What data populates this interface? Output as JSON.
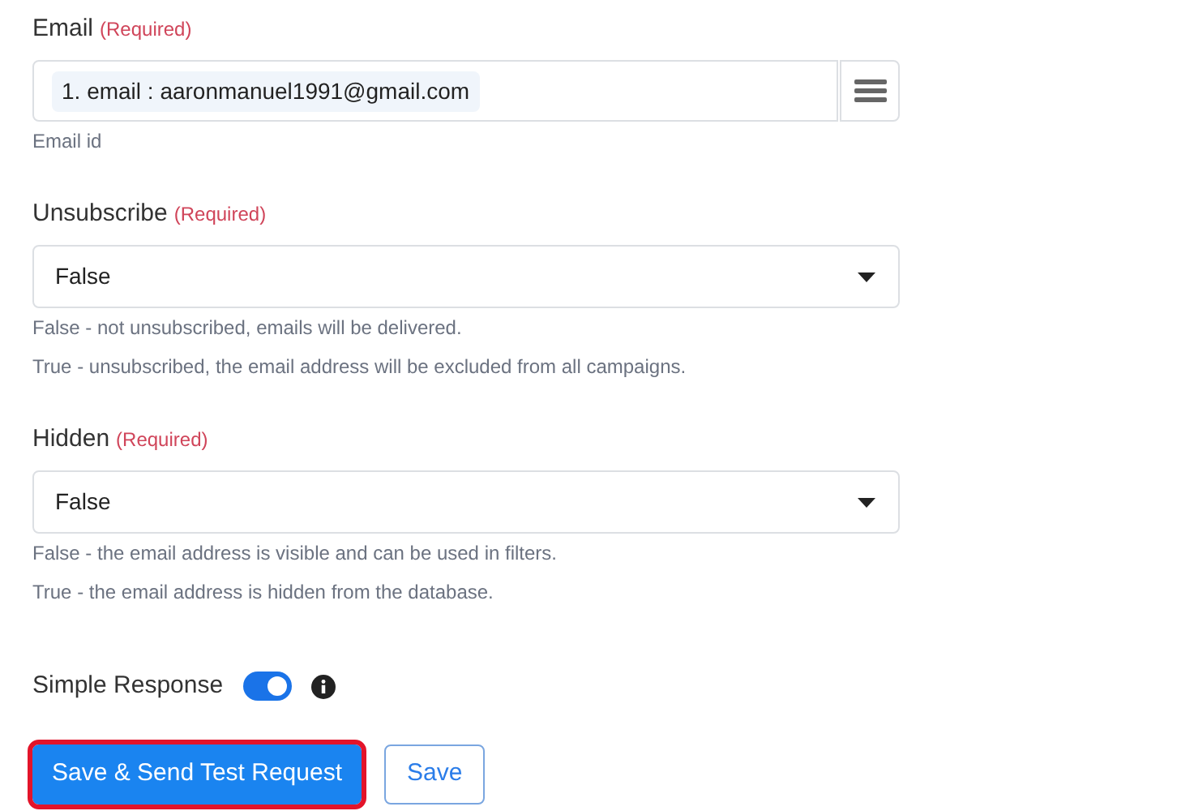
{
  "fields": [
    {
      "kind": "tag_input",
      "label": "Email",
      "required_note": "(Required)",
      "tag": "1. email : aaronmanuel1991@gmail.com",
      "help": [
        "Email id"
      ]
    },
    {
      "kind": "select",
      "label": "Unsubscribe",
      "required_note": "(Required)",
      "value": "False",
      "help": [
        "False - not unsubscribed, emails will be delivered.",
        "True - unsubscribed, the email address will be excluded from all campaigns."
      ]
    },
    {
      "kind": "select",
      "label": "Hidden",
      "required_note": "(Required)",
      "value": "False",
      "help": [
        "False - the email address is visible and can be used in filters.",
        "True - the email address is hidden from the database."
      ]
    }
  ],
  "simple_response": {
    "label": "Simple Response",
    "on": true
  },
  "buttons": [
    {
      "label": "Save & Send Test Request",
      "kind": "primary",
      "highlighted": true
    },
    {
      "label": "Save",
      "kind": "outline",
      "highlighted": false
    }
  ]
}
